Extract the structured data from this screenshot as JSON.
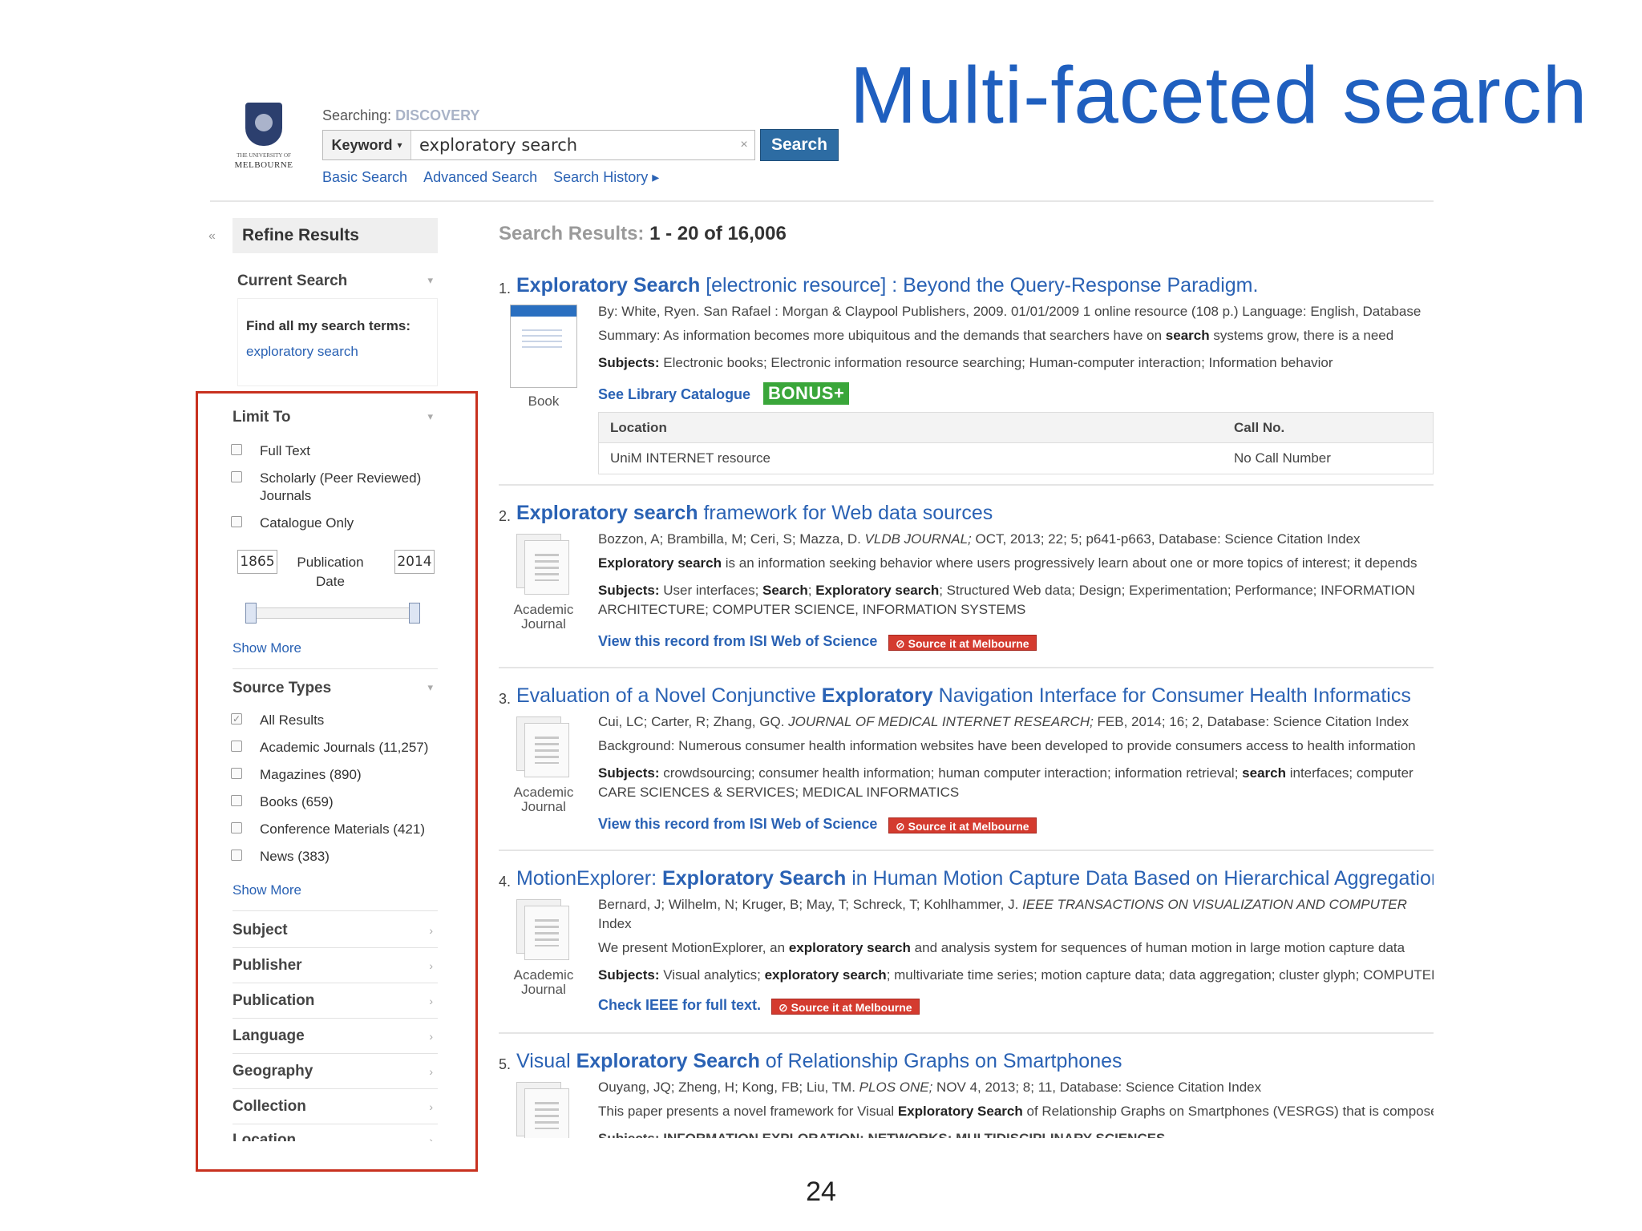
{
  "slide": {
    "title": "Multi-faceted search",
    "page_number": "24"
  },
  "header": {
    "logo": {
      "line1": "THE UNIVERSITY OF",
      "line2": "MELBOURNE"
    },
    "searching_label": "Searching:",
    "searching_scope": "DISCOVERY",
    "search_field_type": "Keyword",
    "search_query": "exploratory search",
    "clear_symbol": "×",
    "search_button": "Search",
    "links": [
      "Basic Search",
      "Advanced Search",
      "Search History ▸"
    ]
  },
  "sidebar": {
    "collapse_symbol": "«",
    "refine_title": "Refine Results",
    "current_search": {
      "heading": "Current Search",
      "find_all_label": "Find all my search terms:",
      "terms": "exploratory search"
    },
    "limit_to": {
      "heading": "Limit To",
      "options": [
        "Full Text",
        "Scholarly (Peer Reviewed) Journals",
        "Catalogue Only"
      ],
      "year_from": "1865",
      "year_to": "2014",
      "date_label_1": "Publication",
      "date_label_2": "Date",
      "show_more": "Show More"
    },
    "source_types": {
      "heading": "Source Types",
      "options": [
        {
          "label": "All Results",
          "checked": true
        },
        {
          "label": "Academic Journals (11,257)",
          "checked": false
        },
        {
          "label": "Magazines (890)",
          "checked": false
        },
        {
          "label": "Books (659)",
          "checked": false
        },
        {
          "label": "Conference Materials (421)",
          "checked": false
        },
        {
          "label": "News (383)",
          "checked": false
        }
      ],
      "show_more": "Show More"
    },
    "facets": [
      "Subject",
      "Publisher",
      "Publication",
      "Language",
      "Geography",
      "Collection",
      "Location"
    ]
  },
  "results": {
    "count_label": "Search Results:",
    "count_value": "1 - 20 of 16,006",
    "items": [
      {
        "num": "1.",
        "title_a": "Exploratory Search",
        "title_b": " [electronic resource] : Beyond the Query-Response Paradigm.",
        "type": "Book",
        "byline": "By: White, Ryen. San Rafael : Morgan & Claypool Publishers, 2009. 01/01/2009 1 online resource (108 p.) Language: English, Database",
        "summary_a": "Summary: As information becomes more ubiquitous and the demands that searchers have on ",
        "summary_k": "search",
        "summary_b": " systems grow, there is a need",
        "subjects_label": "Subjects:",
        "subjects": " Electronic books; Electronic information resource searching; Human-computer interaction; Information behavior",
        "link": "See Library Catalogue",
        "badge": "BONUS+",
        "holdings": {
          "col1": "Location",
          "col2": "Call No.",
          "loc": "UniM INTERNET resource",
          "call": "No Call Number"
        }
      },
      {
        "num": "2.",
        "title_a": "Exploratory search",
        "title_b": " framework for Web data sources",
        "type_1": "Academic",
        "type_2": "Journal",
        "byline_a": "Bozzon, A; Brambilla, M; Ceri, S; Mazza, D. ",
        "byline_i": "VLDB JOURNAL;",
        "byline_b": " OCT, 2013; 22; 5; p641-p663, Database: Science Citation Index",
        "abstract_k": "Exploratory search",
        "abstract_b": " is an information seeking behavior where users progressively learn about one or more topics of interest; it depends",
        "subjects_label": "Subjects:",
        "subjects_a": " User interfaces; ",
        "subjects_k1": "Search",
        "subjects_b": "; ",
        "subjects_k2": "Exploratory search",
        "subjects_c": "; Structured Web data; Design; Experimentation; Performance; INFORMATION",
        "subjects_line2": "ARCHITECTURE; COMPUTER SCIENCE, INFORMATION SYSTEMS",
        "link": "View this record from ISI Web of Science",
        "badge": "⊘ Source it at Melbourne"
      },
      {
        "num": "3.",
        "title_a": "Evaluation of a Novel Conjunctive ",
        "title_k": "Exploratory",
        "title_b": " Navigation Interface for Consumer Health Informatics",
        "type_1": "Academic",
        "type_2": "Journal",
        "byline_a": "Cui, LC; Carter, R; Zhang, GQ. ",
        "byline_i": "JOURNAL OF MEDICAL INTERNET RESEARCH;",
        "byline_b": " FEB, 2014; 16; 2, Database: Science Citation Index",
        "abstract": "Background: Numerous consumer health information websites have been developed to provide consumers access to health information",
        "subjects_label": "Subjects:",
        "subjects_a": " crowdsourcing; consumer health information; human computer interaction; information retrieval; ",
        "subjects_k": "search",
        "subjects_b": " interfaces; computer",
        "subjects_line2": "CARE SCIENCES & SERVICES; MEDICAL INFORMATICS",
        "link": "View this record from ISI Web of Science",
        "badge": "⊘ Source it at Melbourne"
      },
      {
        "num": "4.",
        "title_a": "MotionExplorer: ",
        "title_k": "Exploratory Search",
        "title_b": " in Human Motion Capture Data Based on Hierarchical Aggregation",
        "type_1": "Academic",
        "type_2": "Journal",
        "byline_a": "Bernard, J; Wilhelm, N; Kruger, B; May, T; Schreck, T; Kohlhammer, J. ",
        "byline_i": "IEEE TRANSACTIONS ON VISUALIZATION AND COMPUTER",
        "byline_line2": "Index",
        "abstract_a": "We present MotionExplorer, an ",
        "abstract_k": "exploratory search",
        "abstract_b": " and analysis system for sequences of human motion in large motion capture data",
        "subjects_label": "Subjects:",
        "subjects_a": " Visual analytics; ",
        "subjects_k": "exploratory search",
        "subjects_b": "; multivariate time series; motion capture data; data aggregation; cluster glyph; COMPUTER",
        "link": "Check IEEE for full text.",
        "badge": "⊘ Source it at Melbourne"
      },
      {
        "num": "5.",
        "title_a": "Visual ",
        "title_k": "Exploratory Search",
        "title_b": " of Relationship Graphs on Smartphones",
        "byline_a": "Ouyang, JQ; Zheng, H; Kong, FB; Liu, TM. ",
        "byline_i": "PLOS ONE;",
        "byline_b": " NOV 4, 2013; 8; 11, Database: Science Citation Index",
        "abstract_a": "This paper presents a novel framework for Visual ",
        "abstract_k": "Exploratory Search",
        "abstract_b": " of Relationship Graphs on Smartphones (VESRGS) that is composed",
        "subjects_cut": "Subjects: INFORMATION EXPLORATION; NETWORKS; MULTIDISCIPLINARY SCIENCES"
      }
    ]
  },
  "colors": {
    "title_blue": "#1f5fbf",
    "link_blue": "#2a62b4",
    "highlight_red": "#c8311f",
    "button_blue": "#2d6ca3",
    "bonus_green": "#3aa63a"
  }
}
